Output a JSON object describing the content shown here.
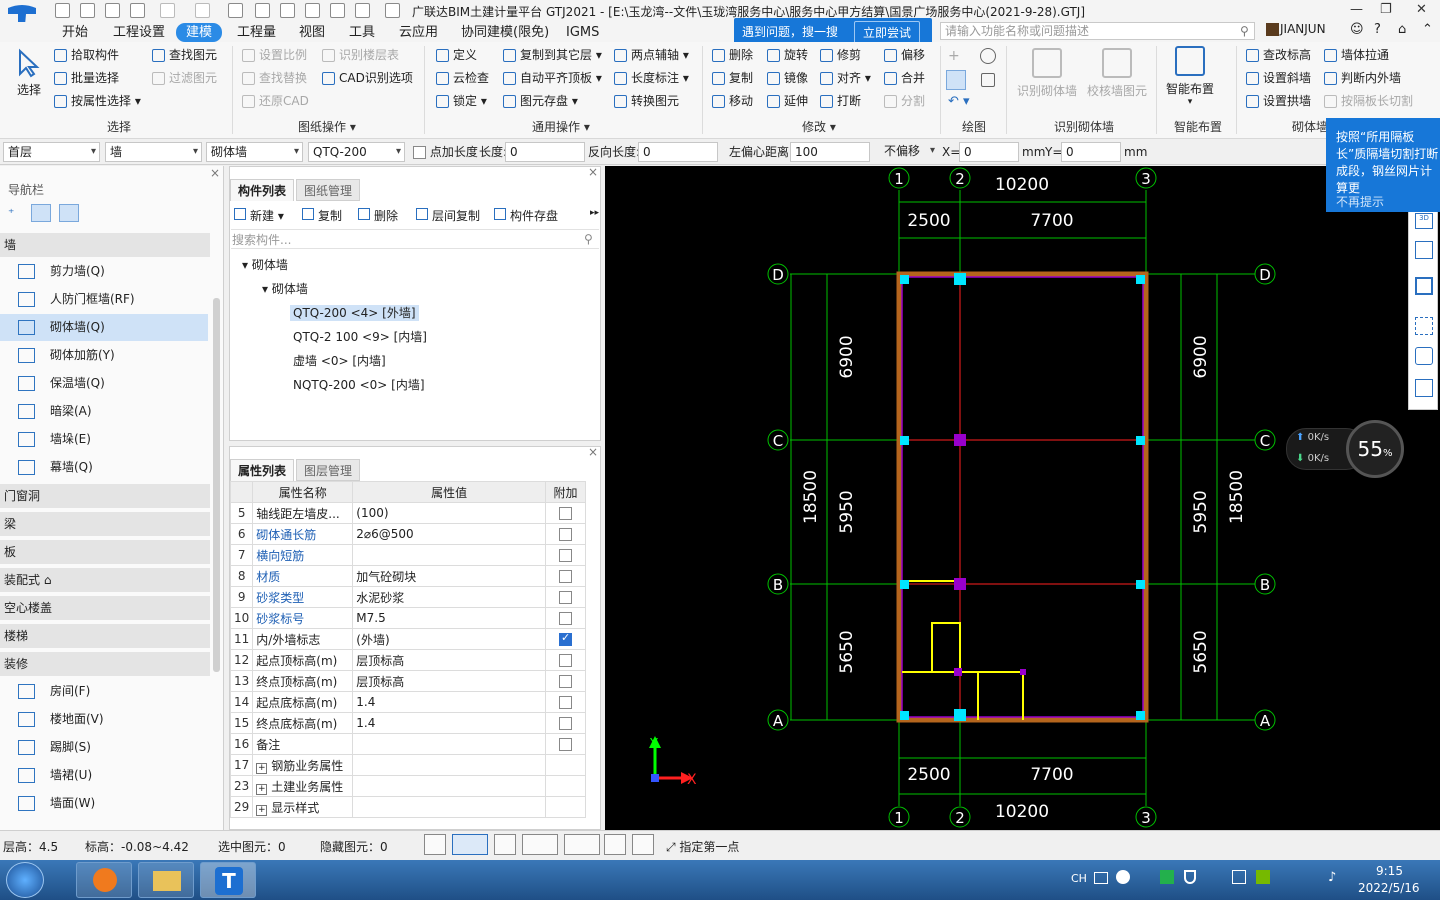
{
  "window": {
    "title": "广联达BIM土建计量平台 GTJ2021 - [E:\\玉龙湾--文件\\玉珑湾服务中心\\服务中心甲方结算\\国景广场服务中心(2021-9-28).GTJ]"
  },
  "menus": [
    "开始",
    "工程设置",
    "建模",
    "工程量",
    "视图",
    "工具",
    "云应用",
    "协同建模(限免)",
    "IGMS"
  ],
  "active_menu": "建模",
  "notice": {
    "message": "遇到问题，搜一搜",
    "button": "立即尝试"
  },
  "search": {
    "placeholder": "请输入功能名称或问题描述"
  },
  "user": {
    "name": "JIANJUN"
  },
  "ribbon": {
    "select_big": "选择",
    "select_group": [
      "拾取构件",
      "批量选择",
      "按属性选择"
    ],
    "drawing_ops": [
      "设置比例",
      "识别楼层表",
      "查找替换",
      "CAD识别选项",
      "还原CAD"
    ],
    "find_elements": [
      "查找图元",
      "过滤图元"
    ],
    "general_ops": [
      "定义",
      "复制到其它层",
      "两点辅轴",
      "云检查",
      "自动平齐顶板",
      "长度标注",
      "锁定",
      "图元存盘",
      "转换图元"
    ],
    "modify": [
      "删除",
      "旋转",
      "修剪",
      "偏移",
      "复制",
      "镜像",
      "对齐",
      "合并",
      "移动",
      "延伸",
      "打断",
      "分割"
    ],
    "recognize": [
      "识别砌体墙",
      "校核墙图元"
    ],
    "smart": "智能布置",
    "wall_tools": [
      "查改标高",
      "墙体拉通",
      "设置斜墙",
      "判断内外墙",
      "设置拱墙",
      "按隔板长切割"
    ],
    "groups": [
      "选择",
      "图纸操作",
      "通用操作",
      "修改",
      "绘图",
      "识别砌体墙",
      "智能布置",
      "砌体墙"
    ]
  },
  "propbar": {
    "floor": "首层",
    "type": "墙",
    "sub_type": "砌体墙",
    "component": "QTQ-200",
    "add_length_label": "点加长度",
    "length_label": "长度:",
    "length_value": "0",
    "reverse_label": "反向长度:",
    "reverse_value": "0",
    "offset_label": "左偏心距离:",
    "offset_value": "100",
    "no_offset": "不偏移",
    "x_label": "X=",
    "x_value": "0",
    "mm1": "mm",
    "y_label": "Y=",
    "y_value": "0",
    "mm2": "mm"
  },
  "nav": {
    "title": "导航栏",
    "section_wall": "墙",
    "wall_items": [
      "剪力墙(Q)",
      "人防门框墙(RF)",
      "砌体墙(Q)",
      "砌体加筋(Y)",
      "保温墙(Q)",
      "暗梁(A)",
      "墙垛(E)",
      "幕墙(Q)"
    ],
    "selected": "砌体墙(Q)",
    "sections": [
      "门窗洞",
      "梁",
      "板",
      "装配式",
      "空心楼盖",
      "楼梯",
      "装修"
    ],
    "decor_items": [
      "房间(F)",
      "楼地面(V)",
      "踢脚(S)",
      "墙裙(U)",
      "墙面(W)"
    ]
  },
  "component_list": {
    "tabs": [
      "构件列表",
      "图纸管理"
    ],
    "tools": [
      "新建",
      "复制",
      "删除",
      "层间复制",
      "构件存盘"
    ],
    "search_placeholder": "搜索构件...",
    "tree_root": "砌体墙",
    "tree_sub": "砌体墙",
    "items": [
      "QTQ-200 <4> [外墙]",
      "QTQ-2  100 <9> [内墙]",
      "虚墙 <0> [内墙]",
      "NQTQ-200 <0> [内墙]"
    ]
  },
  "properties": {
    "tabs": [
      "属性列表",
      "图层管理"
    ],
    "headers": [
      "属性名称",
      "属性值",
      "附加"
    ],
    "rows": [
      {
        "n": "5",
        "k": "轴线距左墙皮...",
        "v": "(100)",
        "blue": false,
        "check": false
      },
      {
        "n": "6",
        "k": "砌体通长筋",
        "v": "2⌀6@500",
        "blue": true,
        "check": false
      },
      {
        "n": "7",
        "k": "横向短筋",
        "v": "",
        "blue": true,
        "check": false
      },
      {
        "n": "8",
        "k": "材质",
        "v": "加气砼砌块",
        "blue": true,
        "check": false
      },
      {
        "n": "9",
        "k": "砂浆类型",
        "v": "水泥砂浆",
        "blue": true,
        "check": false
      },
      {
        "n": "10",
        "k": "砂浆标号",
        "v": "M7.5",
        "blue": true,
        "check": false
      },
      {
        "n": "11",
        "k": "内/外墙标志",
        "v": "(外墙)",
        "blue": false,
        "check": true
      },
      {
        "n": "12",
        "k": "起点顶标高(m)",
        "v": "层顶标高",
        "blue": false,
        "check": false
      },
      {
        "n": "13",
        "k": "终点顶标高(m)",
        "v": "层顶标高",
        "blue": false,
        "check": false
      },
      {
        "n": "14",
        "k": "起点底标高(m)",
        "v": "1.4",
        "blue": false,
        "check": false
      },
      {
        "n": "15",
        "k": "终点底标高(m)",
        "v": "1.4",
        "blue": false,
        "check": false
      },
      {
        "n": "16",
        "k": "备注",
        "v": "",
        "blue": false,
        "check": false
      }
    ],
    "groups": [
      {
        "n": "17",
        "k": "钢筋业务属性"
      },
      {
        "n": "23",
        "k": "土建业务属性"
      },
      {
        "n": "29",
        "k": "显示样式"
      }
    ]
  },
  "canvas": {
    "axes_v": [
      "1",
      "2",
      "3"
    ],
    "axes_h": [
      "D",
      "C",
      "B",
      "A"
    ],
    "dim_top_total": "10200",
    "dim_top_a": "2500",
    "dim_top_b": "7700",
    "dim_side_a": "6900",
    "dim_side_b": "5950",
    "dim_side_c": "5650",
    "dim_side_total": "18500",
    "axis_x": "X",
    "axis_y": "Y",
    "colors": {
      "grid": "#00c000",
      "wall": "#b5651d",
      "accent": "#9900cc",
      "column": "#00ffff",
      "red": "#ff2020",
      "yellow": "#ffff00"
    }
  },
  "tip": {
    "text": "按照“所用隔板长”质隔墙切割打断成段，钢丝网片计算更",
    "dismiss": "不再提示"
  },
  "speed": {
    "up": "0",
    "down": "0",
    "unit": "K/s",
    "percent": "55",
    "pct": "%"
  },
  "status": {
    "floor_height_label": "层高：",
    "floor_height": "4.5",
    "elev_label": "标高：",
    "elev": "-0.08~4.42",
    "selected_label": "选中图元：",
    "selected": "0",
    "hidden_label": "隐藏图元：",
    "hidden": "0",
    "hint": "指定第一点"
  },
  "clock": {
    "time": "9:15",
    "date": "2022/5/16",
    "lang": "CH"
  }
}
